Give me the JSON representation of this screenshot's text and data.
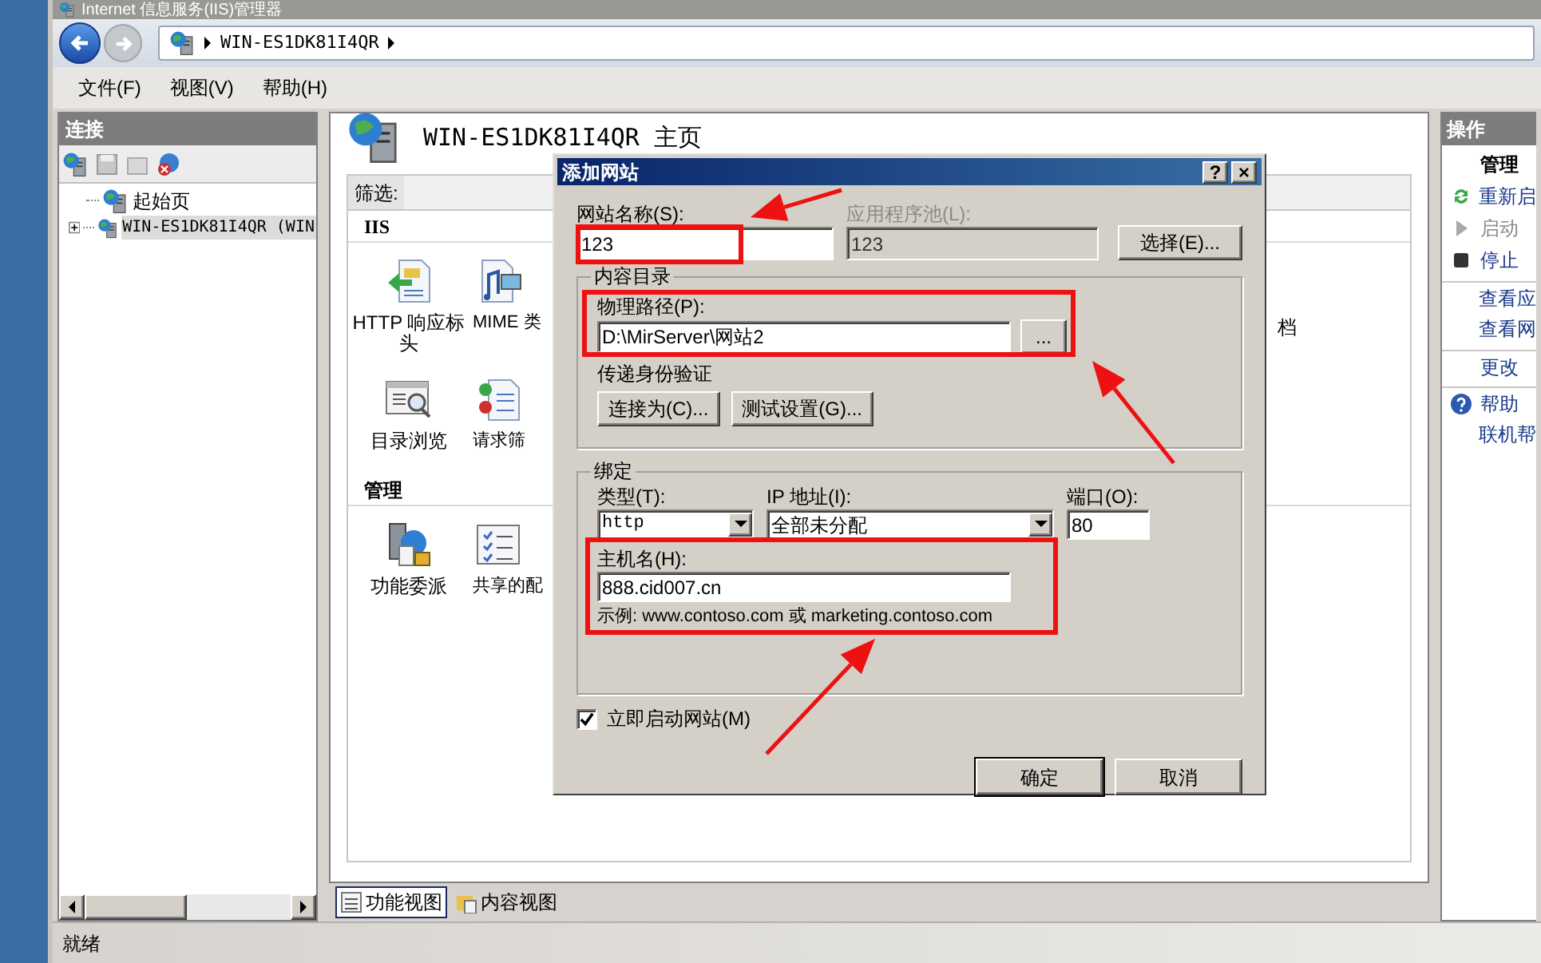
{
  "window": {
    "title": "Internet 信息服务(IIS)管理器"
  },
  "address_bar": {
    "segments": [
      "WIN-ES1DK81I4QR"
    ]
  },
  "menu": [
    "文件(F)",
    "视图(V)",
    "帮助(H)"
  ],
  "connections": {
    "title": "连接",
    "tree": [
      {
        "label": "起始页",
        "has_children": false,
        "selected": false
      },
      {
        "label": "WIN-ES1DK81I4QR (WIN",
        "has_children": true,
        "selected": true
      }
    ]
  },
  "home": {
    "title": "WIN-ES1DK81I4QR 主页",
    "filter_label": "筛选:",
    "sections": [
      {
        "title": "IIS",
        "features": [
          {
            "label": "HTTP 响应标头",
            "kind": "headers"
          },
          {
            "label": "MIME 类",
            "kind": "mime"
          },
          {
            "label": "目录浏览",
            "kind": "browse"
          },
          {
            "label": "请求筛",
            "kind": "filter"
          }
        ],
        "partial_label": "档"
      },
      {
        "title": "管理",
        "features": [
          {
            "label": "功能委派",
            "kind": "delegation"
          },
          {
            "label": "共享的配",
            "kind": "config"
          }
        ]
      }
    ]
  },
  "view_tabs": [
    {
      "label": "功能视图",
      "selected": true
    },
    {
      "label": "内容视图",
      "selected": false
    }
  ],
  "actions": {
    "title": "操作",
    "items": [
      {
        "label": "管理",
        "kind": "heading",
        "disabled": false
      },
      {
        "label": "重新启",
        "kind": "restart",
        "disabled": false
      },
      {
        "label": "启动",
        "kind": "start",
        "disabled": true
      },
      {
        "label": "停止",
        "kind": "stop",
        "disabled": false
      },
      {
        "label": "查看应",
        "kind": "link",
        "disabled": false
      },
      {
        "label": "查看网",
        "kind": "link",
        "disabled": false
      },
      {
        "label": "更改",
        "kind": "link",
        "disabled": false
      },
      {
        "label": "帮助",
        "kind": "help",
        "disabled": false
      },
      {
        "label": "联机帮",
        "kind": "link",
        "disabled": false
      }
    ]
  },
  "status_bar": "就绪",
  "dialog": {
    "title": "添加网站",
    "title_buttons": [
      "?",
      "×"
    ],
    "site_name": {
      "label": "网站名称(S):",
      "value": "123"
    },
    "app_pool": {
      "label": "应用程序池(L):",
      "value": "123",
      "disabled": true
    },
    "select_button": "选择(E)...",
    "content_dir": {
      "title": "内容目录",
      "path_label": "物理路径(P):",
      "path_value": "D:\\MirServer\\网站2",
      "browse_button": "...",
      "auth_label": "传递身份验证",
      "buttons": [
        "连接为(C)...",
        "测试设置(G)..."
      ]
    },
    "binding": {
      "title": "绑定",
      "type_label": "类型(T):",
      "type_value": "http",
      "ip_label": "IP 地址(I):",
      "ip_value": "全部未分配",
      "port_label": "端口(O):",
      "port_value": "80",
      "host_label": "主机名(H):",
      "host_value": "888.cid007.cn",
      "example": "示例: www.contoso.com 或 marketing.contoso.com"
    },
    "start_now": {
      "label": "立即启动网站(M)",
      "checked": true
    },
    "buttons": [
      "确定",
      "取消"
    ]
  }
}
